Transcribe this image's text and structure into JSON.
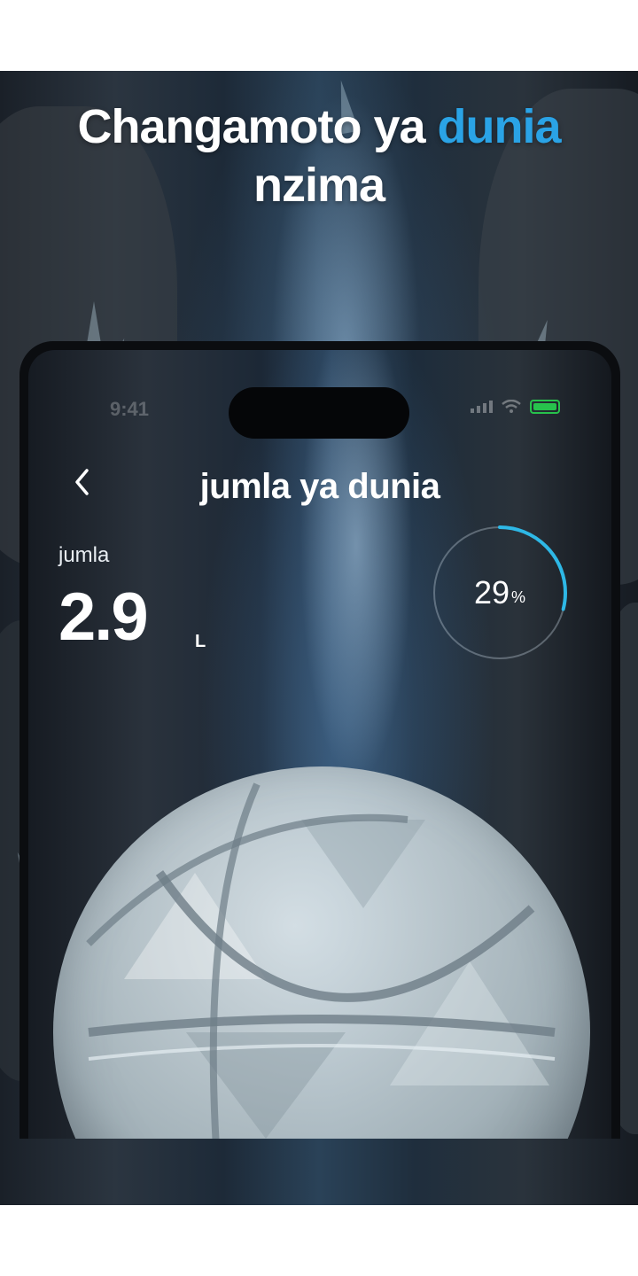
{
  "headline": {
    "part1": "Changamoto ya ",
    "accent": "dunia",
    "part2": "nzima",
    "accent_color": "#2aa3e6"
  },
  "status_bar": {
    "time": "9:41",
    "battery_color": "#27c24c"
  },
  "header": {
    "back_icon": "chevron-left-icon",
    "title": "jumla ya dunia"
  },
  "summary": {
    "label": "jumla",
    "value": "2.9",
    "unit": "L"
  },
  "progress": {
    "value": "29",
    "unit": "%",
    "fraction": 0.29,
    "ring_color": "#2eb8e6"
  }
}
